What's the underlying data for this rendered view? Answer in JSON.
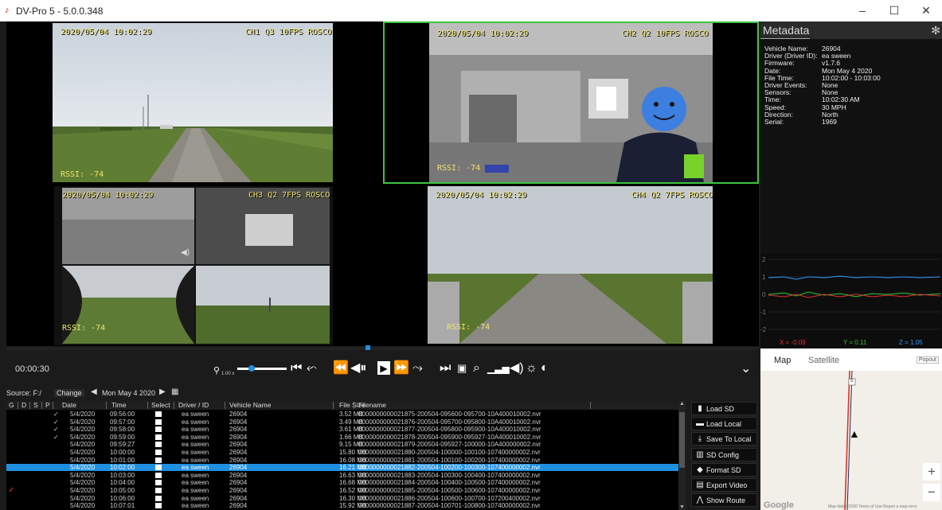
{
  "window": {
    "title": "DV-Pro 5 - 5.0.0.348",
    "controls": [
      "–",
      "☐",
      "✕"
    ]
  },
  "cameras": [
    {
      "timestamp": "2020/05/04 10:02:29",
      "label": "CH1 Q3 10FPS ROSCO",
      "rssi": "RSSI: -74"
    },
    {
      "timestamp": "2020/05/04 10:02:29",
      "label": "CH2 Q2 10FPS ROSCO",
      "rssi": "RSSI: -74"
    },
    {
      "timestamp": "2020/05/04 10:02:29",
      "label": "CH3 Q2 7FPS ROSCO",
      "rssi": "RSSI: -74"
    },
    {
      "timestamp": "2020/05/04 10:02:29",
      "label": "CH4 Q2 7FPS ROSCO",
      "rssi": "RSSI: -74"
    }
  ],
  "metadata": {
    "tab": "Metadata",
    "fields": [
      {
        "label": "Vehicle Name:",
        "value": "26904"
      },
      {
        "label": "Driver (Driver ID):",
        "value": "ea sween"
      },
      {
        "label": "Firmware:",
        "value": "v1.7.6"
      },
      {
        "label": "Date:",
        "value": "Mon May 4 2020"
      },
      {
        "label": "File Time:",
        "value": "10:02:00 - 10:03:00"
      },
      {
        "label": "Driver Events:",
        "value": "None"
      },
      {
        "label": "Sensors:",
        "value": "None"
      },
      {
        "label": "Time:",
        "value": "10:02:30 AM"
      },
      {
        "label": "Speed:",
        "value": "30 MPH"
      },
      {
        "label": "Direction:",
        "value": "North"
      },
      {
        "label": "Serial:",
        "value": "1969"
      }
    ]
  },
  "accelerometer": {
    "ticks": [
      "2",
      "1",
      "0",
      "-1",
      "-2"
    ],
    "x_label": "X = -0.09",
    "y_label": "Y = 0.11",
    "z_label": "Z = 1.05",
    "colors": {
      "x": "#e03030",
      "y": "#30c030",
      "z": "#3399ff"
    }
  },
  "playback": {
    "elapsed": "00:00:30",
    "speed": "1.00 x",
    "progress": 0.48
  },
  "source_bar": {
    "source": "Source: F:/",
    "change": "Change",
    "date": "Mon May 4 2020"
  },
  "file_list": {
    "columns": [
      "G",
      "D",
      "S",
      "P",
      "Date",
      "Time",
      "Select",
      "Driver / ID",
      "Vehicle Name",
      "File Size",
      "Filename"
    ],
    "rows": [
      {
        "p": "✓",
        "date": "5/4/2020",
        "time": "09:56:00",
        "driver": "ea sween",
        "vehicle": "26904",
        "size": "3.52 MB",
        "filename": "0000000000021875-200504-095600-095700-10A400010002.nvr"
      },
      {
        "p": "✓",
        "date": "5/4/2020",
        "time": "09:57:00",
        "driver": "ea sween",
        "vehicle": "26904",
        "size": "3.49 MB",
        "filename": "0000000000021876-200504-095700-095800-10A400010002.nvr"
      },
      {
        "p": "✓",
        "date": "5/4/2020",
        "time": "09:58:00",
        "driver": "ea sween",
        "vehicle": "26904",
        "size": "3.61 MB",
        "filename": "0000000000021877-200504-095800-095900-10A400010002.nvr"
      },
      {
        "p": "✓",
        "date": "5/4/2020",
        "time": "09:59:00",
        "driver": "ea sween",
        "vehicle": "26904",
        "size": "1.66 MB",
        "filename": "0000000000021878-200504-095900-095927-10A400010002.nvr"
      },
      {
        "p": "",
        "date": "5/4/2020",
        "time": "09:59:27",
        "driver": "ea sween",
        "vehicle": "26904",
        "size": "9.15 MB",
        "filename": "0000000000021879-200504-095927-100000-10A400000002.nvr"
      },
      {
        "p": "",
        "date": "5/4/2020",
        "time": "10:00:00",
        "driver": "ea sween",
        "vehicle": "26904",
        "size": "15.80 MB",
        "filename": "0000000000021880-200504-100000-100100-107400000002.nvr"
      },
      {
        "p": "",
        "date": "5/4/2020",
        "time": "10:01:00",
        "driver": "ea sween",
        "vehicle": "26904",
        "size": "16.08 MB",
        "filename": "0000000000021881-200504-100100-100200-107400000002.nvr"
      },
      {
        "p": "",
        "date": "5/4/2020",
        "time": "10:02:00",
        "driver": "ea sween",
        "vehicle": "26904",
        "size": "16.21 MB",
        "filename": "0000000000021882-200504-100200-100300-107400000002.nvr",
        "selected": true
      },
      {
        "p": "",
        "date": "5/4/2020",
        "time": "10:03:00",
        "driver": "ea sween",
        "vehicle": "26904",
        "size": "16.63 MB",
        "filename": "0000000000021883-200504-100300-100400-107400000002.nvr"
      },
      {
        "p": "",
        "date": "5/4/2020",
        "time": "10:04:00",
        "driver": "ea sween",
        "vehicle": "26904",
        "size": "16.68 MB",
        "filename": "0000000000021884-200504-100400-100500-107400000002.nvr"
      },
      {
        "p": "",
        "date": "5/4/2020",
        "time": "10:05:00",
        "driver": "ea sween",
        "vehicle": "26904",
        "size": "16.52 MB",
        "filename": "0000000000021885-200504-100500-100600-107400000002.nvr",
        "g": "✓"
      },
      {
        "p": "",
        "date": "5/4/2020",
        "time": "10:06:00",
        "driver": "ea sween",
        "vehicle": "26904",
        "size": "16.30 MB",
        "filename": "0000000000021886-200504-100600-100700-107200400002.nvr"
      },
      {
        "p": "",
        "date": "5/4/2020",
        "time": "10:07:01",
        "driver": "ea sween",
        "vehicle": "26904",
        "size": "15.92 MB",
        "filename": "0000000000021887-200504-100701-100800-107400000002.nvr"
      }
    ]
  },
  "side_buttons": [
    {
      "label": "Load SD",
      "icon": "sd-card-icon"
    },
    {
      "label": "Load Local",
      "icon": "hard-drive-icon"
    },
    {
      "label": "Save To Local",
      "icon": "download-icon"
    },
    {
      "label": "SD Config",
      "icon": "config-icon"
    },
    {
      "label": "Format SD",
      "icon": "eraser-icon"
    },
    {
      "label": "Export Video",
      "icon": "film-icon"
    },
    {
      "label": "Show Route",
      "icon": "route-icon"
    }
  ],
  "map": {
    "tabs": [
      "Map",
      "Satellite"
    ],
    "popout": "Popout",
    "zoom_in": "+",
    "zoom_out": "−",
    "road_shield": "5",
    "logo": "Google",
    "footer": "Map data ©2020   Terms of Use   Report a map error"
  }
}
